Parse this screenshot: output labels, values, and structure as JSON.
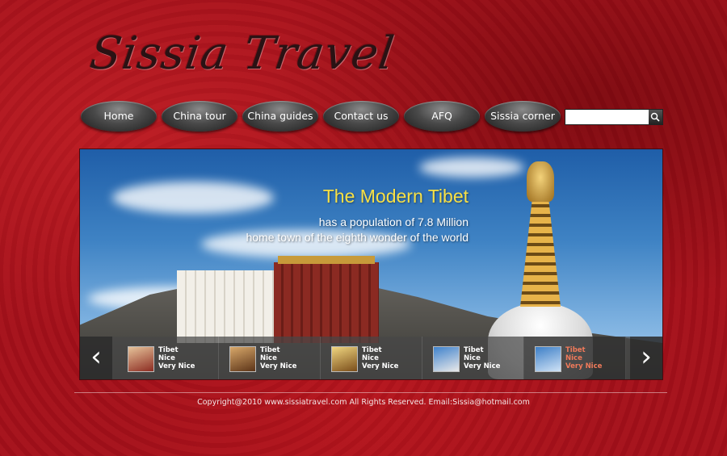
{
  "brand": {
    "logo_text": "Sissia Travel"
  },
  "nav": {
    "items": [
      {
        "label": "Home"
      },
      {
        "label": "China tour"
      },
      {
        "label": "China guides"
      },
      {
        "label": "Contact us"
      },
      {
        "label": "AFQ"
      },
      {
        "label": "Sissia corner"
      }
    ]
  },
  "search": {
    "value": "",
    "placeholder": "",
    "button_icon": "search-icon"
  },
  "banner": {
    "headline": "The Modern Tibet",
    "line1": "has a population of 7.8 Million",
    "line2": "home town of the eighth wonder of the world",
    "headline_color": "#f7e046"
  },
  "thumbnails": [
    {
      "title": "Tibet",
      "line1": "Nice",
      "line2": "Very Nice"
    },
    {
      "title": "Tibet",
      "line1": "Nice",
      "line2": "Very Nice"
    },
    {
      "title": "Tibet",
      "line1": "Nice",
      "line2": "Very Nice"
    },
    {
      "title": "Tibet",
      "line1": "Nice",
      "line2": "Very Nice"
    },
    {
      "title": "Tibet",
      "line1": "Nice",
      "line2": "Very Nice",
      "active": true
    }
  ],
  "carousel": {
    "prev_icon": "chevron-left-icon",
    "next_icon": "chevron-right-icon",
    "prev_glyph": "‹",
    "next_glyph": "›"
  },
  "footer": {
    "text": "Copyright@2010 www.sissiatravel.com All Rights Reserved. Email:Sissia@hotmail.com"
  },
  "colors": {
    "background": "#a5101a",
    "nav_button": "#3a3a3a",
    "active_thumb_text": "#f07a5a"
  }
}
